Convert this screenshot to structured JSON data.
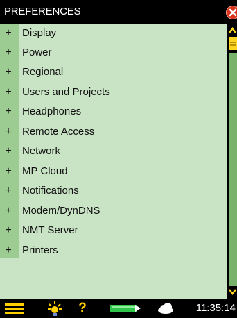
{
  "window": {
    "title": "PREFERENCES"
  },
  "preferences": {
    "items": [
      {
        "expand": "+",
        "label": "Display"
      },
      {
        "expand": "+",
        "label": "Power"
      },
      {
        "expand": "+",
        "label": "Regional"
      },
      {
        "expand": "+",
        "label": "Users and Projects"
      },
      {
        "expand": "+",
        "label": "Headphones"
      },
      {
        "expand": "+",
        "label": "Remote Access"
      },
      {
        "expand": "+",
        "label": "Network"
      },
      {
        "expand": "+",
        "label": "MP Cloud"
      },
      {
        "expand": "+",
        "label": "Notifications"
      },
      {
        "expand": "+",
        "label": "Modem/DynDNS"
      },
      {
        "expand": "+",
        "label": "NMT Server"
      },
      {
        "expand": "+",
        "label": "Printers"
      }
    ]
  },
  "statusbar": {
    "help_glyph": "?",
    "time": "11:35:14",
    "icons": [
      "menu-icon",
      "light-icon",
      "help-icon",
      "battery-icon",
      "cloud-icon"
    ]
  },
  "colors": {
    "list_background": "#c9e3c5",
    "gutter": "#9ccc92",
    "scrollbar_track": "#79b36b",
    "scrollbar_thumb": "#ffd61f",
    "close_button": "#d7351c",
    "bar_background": "#000000"
  }
}
